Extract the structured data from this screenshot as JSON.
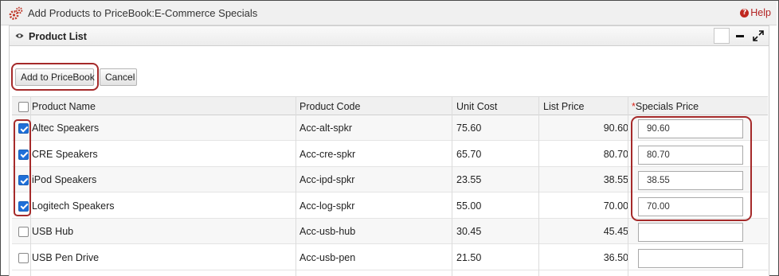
{
  "window": {
    "title": "Add Products to PriceBook:E-Commerce Specials",
    "help_label": "Help"
  },
  "section": {
    "title": "Product List"
  },
  "actions": {
    "add_label": "Add to PriceBook",
    "cancel_label": "Cancel"
  },
  "table": {
    "columns": {
      "product_name": "Product Name",
      "product_code": "Product Code",
      "unit_cost": "Unit Cost",
      "list_price": "List Price",
      "specials_price_marker": "*",
      "specials_price": "Specials Price"
    },
    "rows": [
      {
        "name": "Altec Speakers",
        "code": "Acc-alt-spkr",
        "unit_cost": "75.60",
        "list_price": "90.60",
        "specials_price": "90.60",
        "checked": true
      },
      {
        "name": "CRE Speakers",
        "code": "Acc-cre-spkr",
        "unit_cost": "65.70",
        "list_price": "80.70",
        "specials_price": "80.70",
        "checked": true
      },
      {
        "name": "iPod Speakers",
        "code": "Acc-ipd-spkr",
        "unit_cost": "23.55",
        "list_price": "38.55",
        "specials_price": "38.55",
        "checked": true
      },
      {
        "name": "Logitech Speakers",
        "code": "Acc-log-spkr",
        "unit_cost": "55.00",
        "list_price": "70.00",
        "specials_price": "70.00",
        "checked": true
      },
      {
        "name": "USB Hub",
        "code": "Acc-usb-hub",
        "unit_cost": "30.45",
        "list_price": "45.45",
        "specials_price": "",
        "checked": false
      },
      {
        "name": "USB Pen Drive",
        "code": "Acc-usb-pen",
        "unit_cost": "21.50",
        "list_price": "36.50",
        "specials_price": "",
        "checked": false
      }
    ]
  },
  "icons": {
    "title": "gears-icon",
    "help": "help-icon",
    "section": "eye-icon",
    "maximize": "expand-icon",
    "minimize": "minus-icon"
  },
  "colors": {
    "highlight": "#a52a2a",
    "required_marker": "#d9261c",
    "checkbox_checked": "#1e6fd9",
    "help": "#b22222"
  }
}
